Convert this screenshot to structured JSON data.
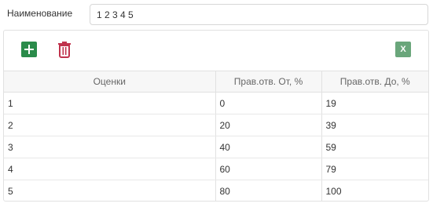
{
  "form": {
    "name_label": "Наименование",
    "name_value": "1 2 3 4 5"
  },
  "toolbar": {
    "add_icon": "plus-icon",
    "delete_icon": "trash-icon",
    "excel_icon": "excel-export-icon",
    "excel_text": "X",
    "colors": {
      "add": "#2a8b4a",
      "delete": "#c0334d",
      "excel": "#6aa67b"
    }
  },
  "grid": {
    "columns": [
      "Оценки",
      "Прав.отв. От, %",
      "Прав.отв. До, %"
    ],
    "rows": [
      [
        "1",
        "0",
        "19"
      ],
      [
        "2",
        "20",
        "39"
      ],
      [
        "3",
        "40",
        "59"
      ],
      [
        "4",
        "60",
        "79"
      ],
      [
        "5",
        "80",
        "100"
      ]
    ]
  }
}
